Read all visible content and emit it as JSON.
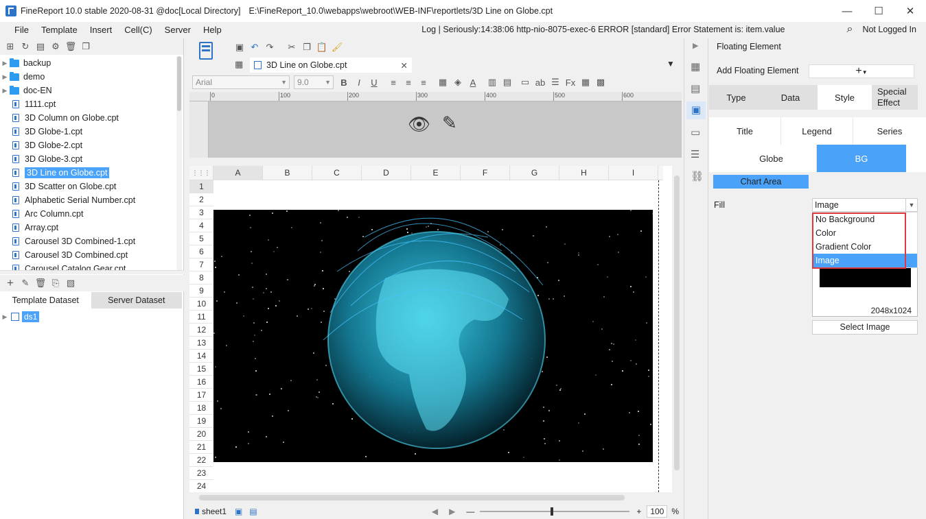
{
  "window": {
    "title": "FineReport 10.0 stable 2020-08-31 @doc[Local Directory]",
    "path": "E:\\FineReport_10.0\\webapps\\webroot\\WEB-INF\\reportlets/3D Line on Globe.cpt"
  },
  "menu": [
    "File",
    "Template",
    "Insert",
    "Cell(C)",
    "Server",
    "Help"
  ],
  "log_message": "Log | Seriously:14:38:06 http-nio-8075-exec-6 ERROR [standard] Error Statement is: item.value",
  "user_status": "Not Logged In",
  "file_tree": [
    {
      "label": "backup",
      "type": "folder"
    },
    {
      "label": "demo",
      "type": "folder"
    },
    {
      "label": "doc-EN",
      "type": "folder"
    },
    {
      "label": "1111.cpt",
      "type": "file"
    },
    {
      "label": "3D Column on Globe.cpt",
      "type": "file"
    },
    {
      "label": "3D Globe-1.cpt",
      "type": "file"
    },
    {
      "label": "3D Globe-2.cpt",
      "type": "file"
    },
    {
      "label": "3D Globe-3.cpt",
      "type": "file"
    },
    {
      "label": "3D Line on Globe.cpt",
      "type": "file",
      "selected": true
    },
    {
      "label": "3D Scatter on Globe.cpt",
      "type": "file"
    },
    {
      "label": "Alphabetic Serial Number.cpt",
      "type": "file"
    },
    {
      "label": "Arc Column.cpt",
      "type": "file"
    },
    {
      "label": "Array.cpt",
      "type": "file"
    },
    {
      "label": "Carousel 3D Combined-1.cpt",
      "type": "file"
    },
    {
      "label": "Carousel 3D Combined.cpt",
      "type": "file"
    },
    {
      "label": "Carousel Catalog Gear.cpt",
      "type": "file"
    }
  ],
  "dataset_tabs": [
    "Template Dataset",
    "Server Dataset"
  ],
  "datasets": [
    "ds1"
  ],
  "doc_tab": "3D Line on Globe.cpt",
  "font": {
    "name": "Arial",
    "size": "9.0"
  },
  "ruler_ticks": [
    "0",
    "100",
    "200",
    "300",
    "400",
    "500",
    "600"
  ],
  "columns": [
    "A",
    "B",
    "C",
    "D",
    "E",
    "F",
    "G",
    "H",
    "I"
  ],
  "rows": [
    "1",
    "2",
    "3",
    "4",
    "5",
    "6",
    "7",
    "8",
    "9",
    "10",
    "11",
    "12",
    "13",
    "14",
    "15",
    "16",
    "17",
    "18",
    "19",
    "20",
    "21",
    "22",
    "23",
    "24"
  ],
  "sheet_tab": "sheet1",
  "zoom": "100",
  "zoom_unit": "%",
  "panel": {
    "title": "Floating Element",
    "add_label": "Add Floating Element",
    "tabs": [
      "Type",
      "Data",
      "Style",
      "Special Effect"
    ],
    "active_tab": "Style",
    "style_tabs": [
      "Title",
      "Legend",
      "Series"
    ],
    "bg_tabs": [
      "Globe",
      "BG"
    ],
    "active_bg_tab": "BG",
    "chart_area": "Chart Area",
    "fill_label": "Fill",
    "fill_value": "Image",
    "fill_options": [
      "No Background",
      "Color",
      "Gradient Color",
      "Image"
    ],
    "selected_option": "Image",
    "image_size": "2048x1024",
    "select_image": "Select Image"
  },
  "colors": {
    "accent": "#4aa3f8",
    "highlight_border": "#e0393e",
    "globe": "#2fb8d8"
  }
}
